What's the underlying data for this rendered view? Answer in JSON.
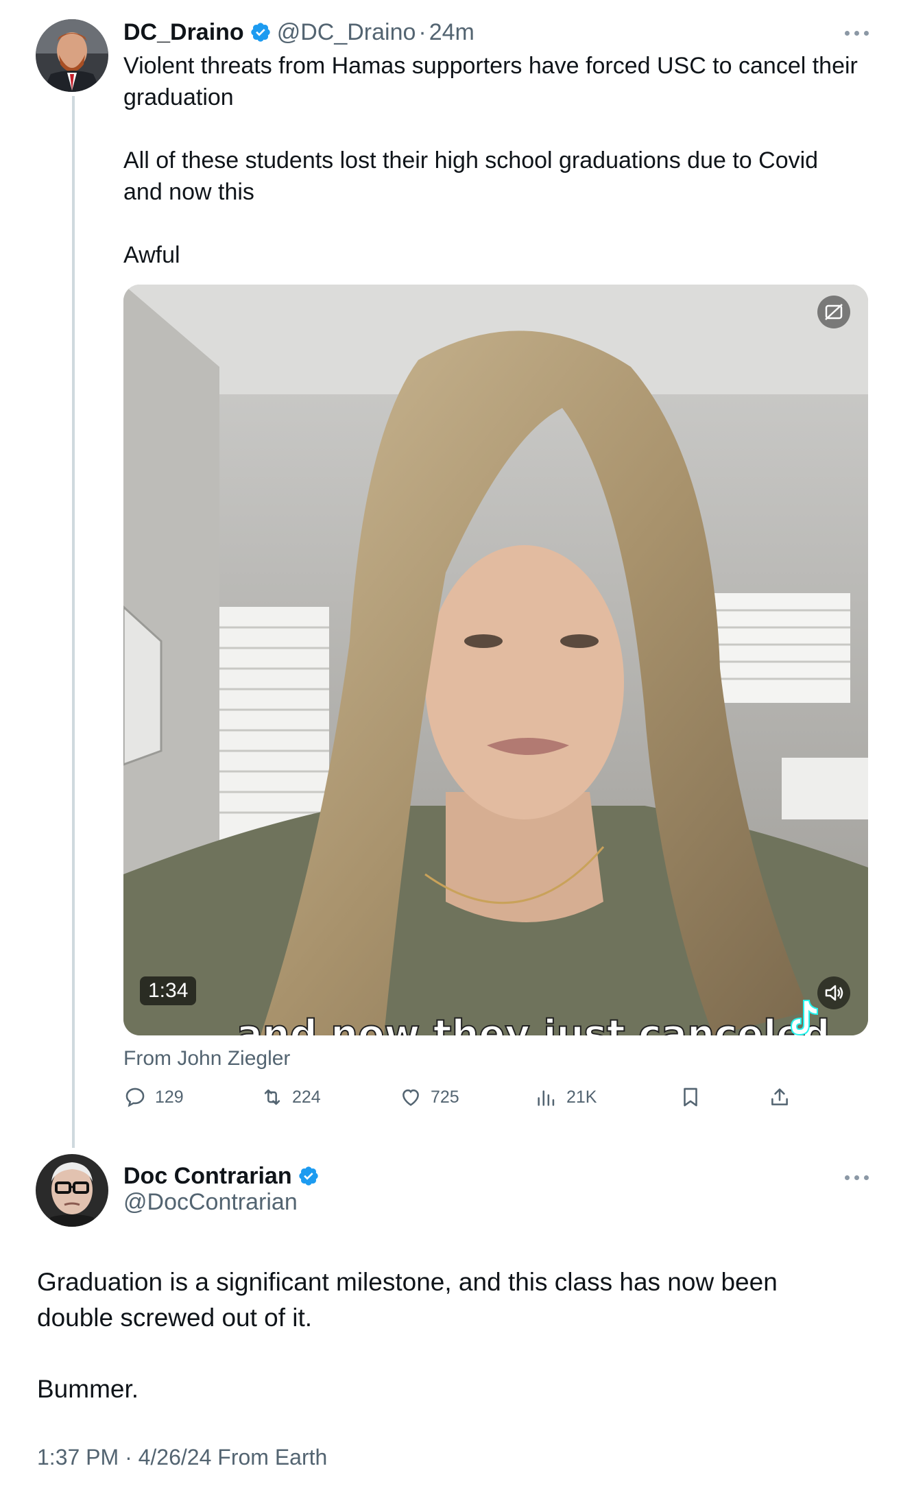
{
  "tweet": {
    "author_name": "DC_Draino",
    "author_handle": "@DC_Draino",
    "separator": "·",
    "time": "24m",
    "text": "Violent threats from Hamas supporters have forced USC to cancel their\ngraduation\n\nAll of these students lost their high school graduations due to Covid\nand now this\n\nAwful",
    "video": {
      "duration": "1:34",
      "caption": "and now they just canceled",
      "source": "From John Ziegler"
    },
    "stats": {
      "replies": "129",
      "reposts": "224",
      "likes": "725",
      "views": "21K"
    }
  },
  "reply": {
    "author_name": "Doc Contrarian",
    "author_handle": "@DocContrarian",
    "text": "Graduation is a significant milestone, and this class has now been\ndouble screwed out of it.\n\nBummer.",
    "timestamp": "1:37 PM · 4/26/24 From Earth"
  },
  "colors": {
    "verified": "#1d9bf0",
    "secondary_text": "#536471",
    "thread_line": "#cfd9de"
  },
  "icons": [
    "verified-badge-icon",
    "more-options-icon",
    "reply-icon",
    "repost-icon",
    "like-icon",
    "views-icon",
    "bookmark-icon",
    "share-icon",
    "volume-icon",
    "captions-icon",
    "tiktok-logo-icon"
  ]
}
